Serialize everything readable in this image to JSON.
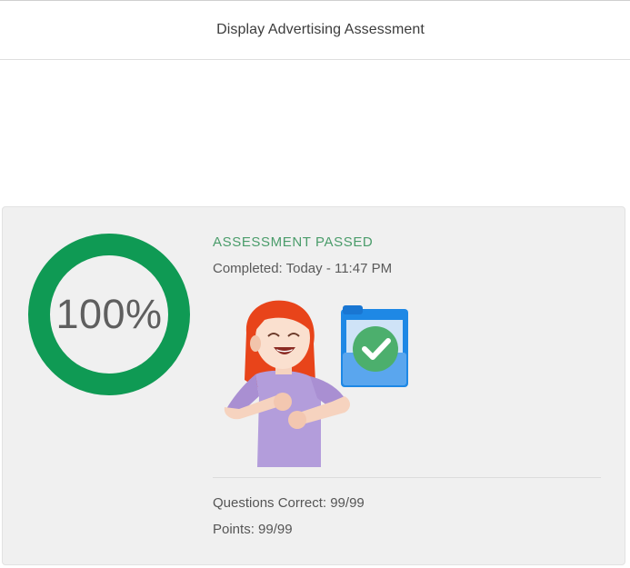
{
  "header": {
    "title": "Display Advertising Assessment"
  },
  "result": {
    "score_label": "100%",
    "score_fraction": 1.0,
    "status": "ASSESSMENT PASSED",
    "completed_label": "Completed:",
    "completed_value": "Today - 11:47 PM",
    "questions_label": "Questions Correct:",
    "questions_value": "99/99",
    "points_label": "Points:",
    "points_value": "99/99"
  },
  "colors": {
    "ring": "#0f9a54",
    "status": "#4a9c6a",
    "card_bg": "#f0f0f0"
  },
  "icons": {
    "illustration": "celebrating-woman-illustration",
    "check": "check-circle-icon"
  }
}
